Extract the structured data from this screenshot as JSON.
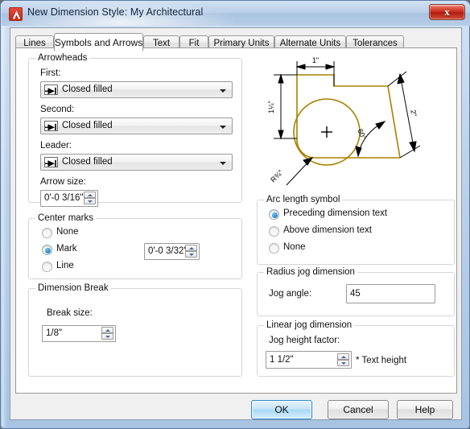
{
  "window": {
    "title": "New Dimension Style: My Architectural",
    "app_icon": "autocad-logo-icon",
    "close_label": "x"
  },
  "tabs": [
    {
      "label": "Lines",
      "active": false
    },
    {
      "label": "Symbols and Arrows",
      "active": true
    },
    {
      "label": "Text",
      "active": false
    },
    {
      "label": "Fit",
      "active": false
    },
    {
      "label": "Primary Units",
      "active": false
    },
    {
      "label": "Alternate Units",
      "active": false
    },
    {
      "label": "Tolerances",
      "active": false
    }
  ],
  "arrowheads": {
    "legend": "Arrowheads",
    "first_label": "First:",
    "first_value": "Closed filled",
    "second_label": "Second:",
    "second_value": "Closed filled",
    "leader_label": "Leader:",
    "leader_value": "Closed filled",
    "arrow_size_label": "Arrow size:",
    "arrow_size_value": "0'-0 3/16\""
  },
  "center_marks": {
    "legend": "Center marks",
    "options": [
      {
        "label": "None",
        "selected": false
      },
      {
        "label": "Mark",
        "selected": true
      },
      {
        "label": "Line",
        "selected": false
      }
    ],
    "size_value": "0'-0 3/32\""
  },
  "dimension_break": {
    "legend": "Dimension Break",
    "break_size_label": "Break size:",
    "break_size_value": "1/8\""
  },
  "arc_length_symbol": {
    "legend": "Arc length symbol",
    "options": [
      {
        "label": "Preceding dimension text",
        "selected": true
      },
      {
        "label": "Above dimension text",
        "selected": false
      },
      {
        "label": "None",
        "selected": false
      }
    ]
  },
  "radius_jog": {
    "legend": "Radius jog dimension",
    "jog_angle_label": "Jog angle:",
    "jog_angle_value": "45"
  },
  "linear_jog": {
    "legend": "Linear jog dimension",
    "jog_height_label": "Jog height factor:",
    "jog_height_value": "1 1/2\"",
    "suffix": "* Text height"
  },
  "preview": {
    "dim_top": "1\"",
    "dim_left": "1¼\"",
    "dim_angle": "60°",
    "dim_radius": "R¾\"",
    "dim_right": "2\"",
    "geometry_color": "#a88200",
    "annotation_color": "#000000",
    "background": "#ffffff"
  },
  "buttons": {
    "ok": "OK",
    "cancel": "Cancel",
    "help": "Help"
  }
}
